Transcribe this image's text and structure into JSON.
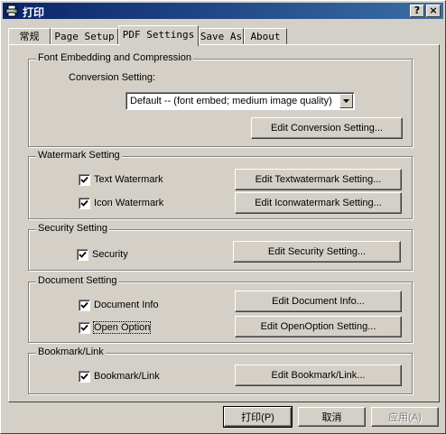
{
  "window": {
    "title": "打印",
    "help_label": "?",
    "close_label": "×"
  },
  "tabs": [
    {
      "label": "常规"
    },
    {
      "label": "Page Setup"
    },
    {
      "label": "PDF Settings"
    },
    {
      "label": "Save As"
    },
    {
      "label": "About"
    }
  ],
  "font_group": {
    "label": "Font Embedding and Compression",
    "conversion_label": "Conversion Setting:",
    "conversion_value": "Default -- (font embed; medium image quality)",
    "edit_button": "Edit Conversion Setting..."
  },
  "watermark_group": {
    "label": "Watermark Setting",
    "text_watermark": {
      "label": "Text Watermark",
      "checked": true
    },
    "text_button": "Edit Textwatermark Setting...",
    "icon_watermark": {
      "label": "Icon Watermark",
      "checked": true
    },
    "icon_button": "Edit Iconwatermark Setting..."
  },
  "security_group": {
    "label": "Security Setting",
    "security": {
      "label": "Security",
      "checked": true
    },
    "button": "Edit Security Setting..."
  },
  "document_group": {
    "label": "Document Setting",
    "doc_info": {
      "label": "Document Info",
      "checked": true
    },
    "doc_info_button": "Edit Document Info...",
    "open_option": {
      "label": "Open Option",
      "checked": true
    },
    "open_option_button": "Edit OpenOption Setting..."
  },
  "bookmark_group": {
    "label": "Bookmark/Link",
    "bookmark": {
      "label": "Bookmark/Link",
      "checked": true
    },
    "button": "Edit Bookmark/Link..."
  },
  "footer": {
    "print_button": "打印(P)",
    "cancel_button": "取消",
    "apply_button": "应用(A)"
  }
}
